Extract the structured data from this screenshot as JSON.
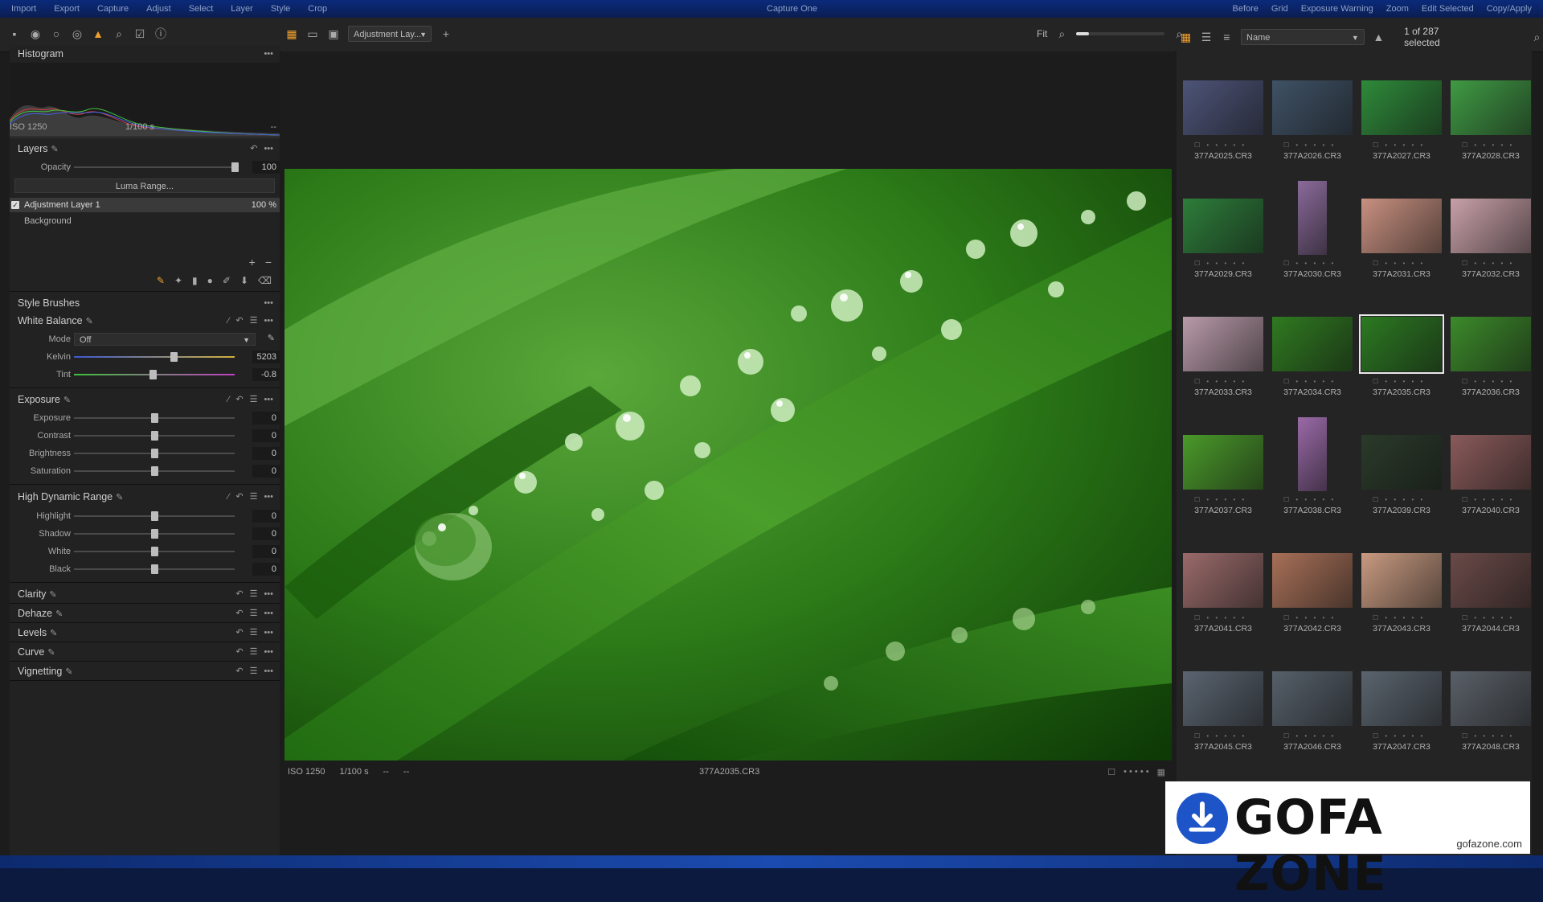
{
  "menubar": {
    "items": [
      "Import",
      "Export",
      "Capture",
      "Adjust",
      "Select",
      "Layer",
      "Style",
      "Crop"
    ],
    "title": "Capture One",
    "right": [
      "Before",
      "Grid",
      "Exposure Warning",
      "Zoom",
      "Edit Selected",
      "Copy/Apply"
    ]
  },
  "toolbar": {
    "layer_select": "Adjustment Lay...",
    "zoom_label": "Fit",
    "zoom_level": 0.14,
    "sort_by": "Name",
    "selected_count": "1 of 287 selected"
  },
  "histogram": {
    "title": "Histogram",
    "iso": "ISO 1250",
    "shutter": "1/100 s",
    "aperture": "--"
  },
  "layers": {
    "title": "Layers",
    "opacity_label": "Opacity",
    "opacity_value": "100",
    "opacity_level": 1.0,
    "luma_button": "Luma Range...",
    "items": [
      {
        "name": "Adjustment Layer 1",
        "opacity": "100 %"
      },
      {
        "name": "Background"
      }
    ]
  },
  "style_brushes": {
    "title": "Style Brushes"
  },
  "white_balance": {
    "title": "White Balance",
    "mode_label": "Mode",
    "mode_value": "Off",
    "kelvin_label": "Kelvin",
    "kelvin_value": "5203",
    "kelvin_level": 0.62,
    "tint_label": "Tint",
    "tint_value": "-0.8",
    "tint_level": 0.49
  },
  "exposure": {
    "title": "Exposure",
    "rows": [
      {
        "label": "Exposure",
        "value": "0",
        "level": 0.5
      },
      {
        "label": "Contrast",
        "value": "0",
        "level": 0.5
      },
      {
        "label": "Brightness",
        "value": "0",
        "level": 0.5
      },
      {
        "label": "Saturation",
        "value": "0",
        "level": 0.5
      }
    ]
  },
  "hdr": {
    "title": "High Dynamic Range",
    "rows": [
      {
        "label": "Highlight",
        "value": "0",
        "level": 0.5
      },
      {
        "label": "Shadow",
        "value": "0",
        "level": 0.5
      },
      {
        "label": "White",
        "value": "0",
        "level": 0.5
      },
      {
        "label": "Black",
        "value": "0",
        "level": 0.5
      }
    ]
  },
  "collapsed_tools": [
    "Clarity",
    "Dehaze",
    "Levels",
    "Curve",
    "Vignetting"
  ],
  "viewer": {
    "iso": "ISO 1250",
    "shutter": "1/100 s",
    "aperture": "--",
    "ev": "--",
    "filename": "377A2035.CR3"
  },
  "browser": {
    "thumbnails": [
      {
        "name": "377A2025.CR3",
        "tone": "#4d5478"
      },
      {
        "name": "377A2026.CR3",
        "tone": "#3f5266"
      },
      {
        "name": "377A2027.CR3",
        "tone": "#2e8a3a"
      },
      {
        "name": "377A2028.CR3",
        "tone": "#3f9a44"
      },
      {
        "name": "377A2029.CR3",
        "tone": "#2d7d3a"
      },
      {
        "name": "377A2030.CR3",
        "tone": "#8a6a9a",
        "portrait": true
      },
      {
        "name": "377A2031.CR3",
        "tone": "#c89080"
      },
      {
        "name": "377A2032.CR3",
        "tone": "#c8a0a8"
      },
      {
        "name": "377A2033.CR3",
        "tone": "#b89aa8"
      },
      {
        "name": "377A2034.CR3",
        "tone": "#2f7a20"
      },
      {
        "name": "377A2035.CR3",
        "tone": "#2c7a22",
        "selected": true
      },
      {
        "name": "377A2036.CR3",
        "tone": "#3c8a2a"
      },
      {
        "name": "377A2037.CR3",
        "tone": "#4a9a2a"
      },
      {
        "name": "377A2038.CR3",
        "tone": "#9a6aa8",
        "portrait": true
      },
      {
        "name": "377A2039.CR3",
        "tone": "#2a3a2a"
      },
      {
        "name": "377A2040.CR3",
        "tone": "#8a5a5a"
      },
      {
        "name": "377A2041.CR3",
        "tone": "#9a6a6a"
      },
      {
        "name": "377A2042.CR3",
        "tone": "#a87058"
      },
      {
        "name": "377A2043.CR3",
        "tone": "#c89a80"
      },
      {
        "name": "377A2044.CR3",
        "tone": "#6a4a48"
      },
      {
        "name": "377A2045.CR3",
        "tone": "#5a6470"
      },
      {
        "name": "377A2046.CR3",
        "tone": "#56606a"
      },
      {
        "name": "377A2047.CR3",
        "tone": "#5a646e"
      },
      {
        "name": "377A2048.CR3",
        "tone": "#5a6068"
      }
    ]
  },
  "watermark": {
    "brand": "GOFA ZONE",
    "site": "gofazone.com"
  },
  "colors": {
    "accent": "#f0a030",
    "panel": "#222222",
    "viewer_bg": "#1c1c1c"
  }
}
